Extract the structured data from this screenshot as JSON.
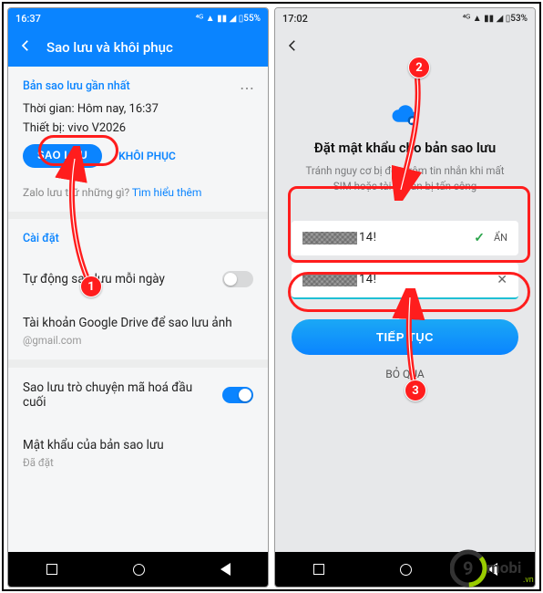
{
  "left": {
    "status_time": "16:37",
    "status_icons": "⁴ᴳ ▲ ▮▮ ◢ ▯55%",
    "header_title": "Sao lưu và khôi phục",
    "section1_title": "Bản sao lưu gần nhất",
    "time_label": "Thời gian: Hôm nay, 16:37",
    "device_label": "Thiết bị: vivo V2026",
    "backup_btn": "SAO LƯU",
    "restore_btn": "KHÔI PHỤC",
    "hint_prefix": "Zalo lưu trữ những gì? ",
    "hint_link": "Tìm hiểu thêm",
    "section2_title": "Cài đặt",
    "auto_backup": "Tự động sao lưu mỗi ngày",
    "gdrive_label": "Tài khoản Google Drive để sao lưu ảnh",
    "gdrive_value": "@gmail.com",
    "e2e_label": "Sao lưu trò chuyện mã hoá đầu cuối",
    "pwd_label": "Mật khẩu của bản sao lưu",
    "pwd_status": "Đã đặt"
  },
  "right": {
    "status_time": "17:02",
    "status_icons": "⁴ᴳ ▲ ▮▮ ◢ ▯53%",
    "title": "Đặt mật khẩu cho bản sao lưu",
    "desc": "Tránh nguy cơ bị đọc trộm tin nhắn khi mất SIM hoặc tài khoản bị tấn công",
    "input1_suffix": "14!",
    "input1_hide": "ẨN",
    "input2_suffix": "14!",
    "continue_btn": "TIẾP TỤC",
    "skip": "BỎ QUA"
  },
  "badges": {
    "b1": "1",
    "b2": "2",
    "b3": "3"
  },
  "watermark": {
    "text": "mobi",
    "suffix": ".vn",
    "digit": "9"
  }
}
